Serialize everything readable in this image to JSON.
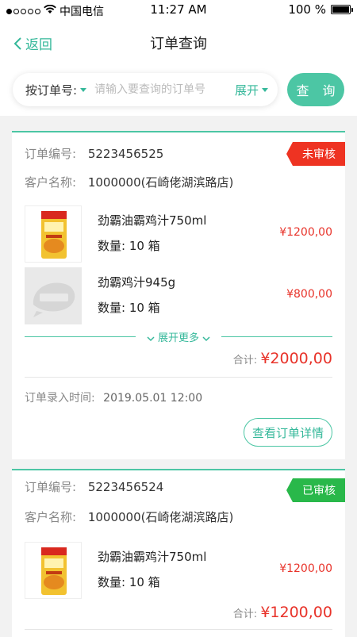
{
  "status_bar": {
    "carrier": "中国电信",
    "time": "11:27 AM",
    "battery": "100 %"
  },
  "nav": {
    "back_label": "返回",
    "title": "订单查询"
  },
  "search": {
    "type_label": "按订单号:",
    "placeholder": "请输入要查询的订单号",
    "expand_label": "展开",
    "query_label": "查 询"
  },
  "colors": {
    "accent": "#4cc6a4",
    "price": "#e8332a",
    "badge_pending": "#ee3322",
    "badge_approved": "#29b84a"
  },
  "orders": [
    {
      "order_no_label": "订单编号:",
      "order_no": "5223456525",
      "status": "未审核",
      "customer_label": "客户名称:",
      "customer": "1000000(石崎佬湖滨路店)",
      "items": [
        {
          "name": "劲霸油霸鸡汁750ml",
          "qty": "数量:  10 箱",
          "price": "¥1200,00",
          "image": "product-bottle"
        },
        {
          "name": "劲霸鸡汁945g",
          "qty": "数量:  10 箱",
          "price": "¥800,00",
          "image": "image-placeholder"
        }
      ],
      "expand_more": "展开更多",
      "total_label": "合计:",
      "total": "¥2000,00",
      "entry_time_label": "订单录入时间:",
      "entry_time": "2019.05.01 12:00",
      "detail_button": "查看订单详情"
    },
    {
      "order_no_label": "订单编号:",
      "order_no": "5223456524",
      "status": "已审核",
      "customer_label": "客户名称:",
      "customer": "1000000(石崎佬湖滨路店)",
      "items": [
        {
          "name": "劲霸油霸鸡汁750ml",
          "qty": "数量:  10 箱",
          "price": "¥1200,00",
          "image": "product-bottle"
        }
      ],
      "total_label": "合计:",
      "total": "¥1200,00"
    }
  ]
}
